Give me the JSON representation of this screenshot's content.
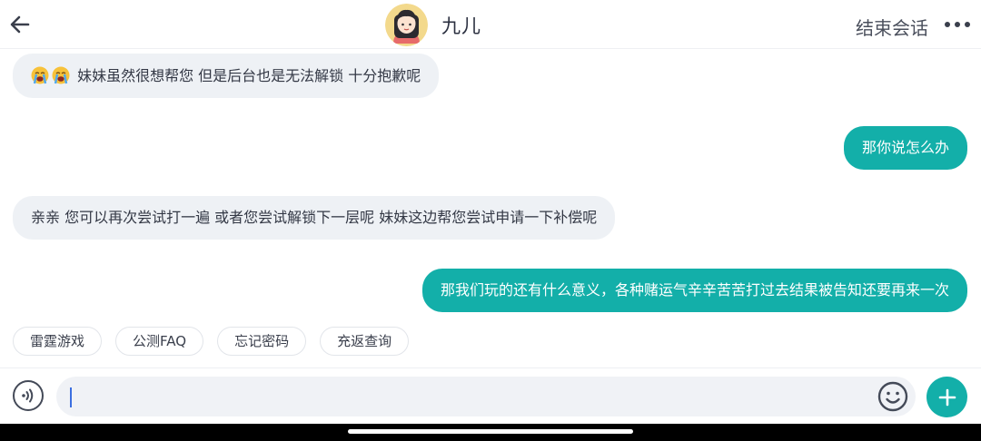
{
  "header": {
    "agent_name": "九儿",
    "end_chat_label": "结束会话",
    "avatar_icon": "girl-avatar",
    "back_icon": "back-arrow-icon",
    "more_icon": "more-dots-icon"
  },
  "messages": [
    {
      "side": "left",
      "emoji": [
        "loudly-crying-face",
        "loudly-crying-face"
      ],
      "text": "妹妹虽然很想帮您 但是后台也是无法解锁 十分抱歉呢"
    },
    {
      "side": "right",
      "text": "那你说怎么办"
    },
    {
      "side": "left",
      "text": "亲亲 您可以再次尝试打一遍 或者您尝试解锁下一层呢 妹妹这边帮您尝试申请一下补偿呢"
    },
    {
      "side": "right",
      "text": "那我们玩的还有什么意义，各种赌运气辛辛苦苦打过去结果被告知还要再来一次"
    }
  ],
  "quick_replies": [
    "雷霆游戏",
    "公测FAQ",
    "忘记密码",
    "充返查询"
  ],
  "input": {
    "value": "",
    "placeholder": ""
  },
  "colors": {
    "accent": "#13afa9",
    "bubble_left": "#eef1f5",
    "text": "#2b3040"
  }
}
